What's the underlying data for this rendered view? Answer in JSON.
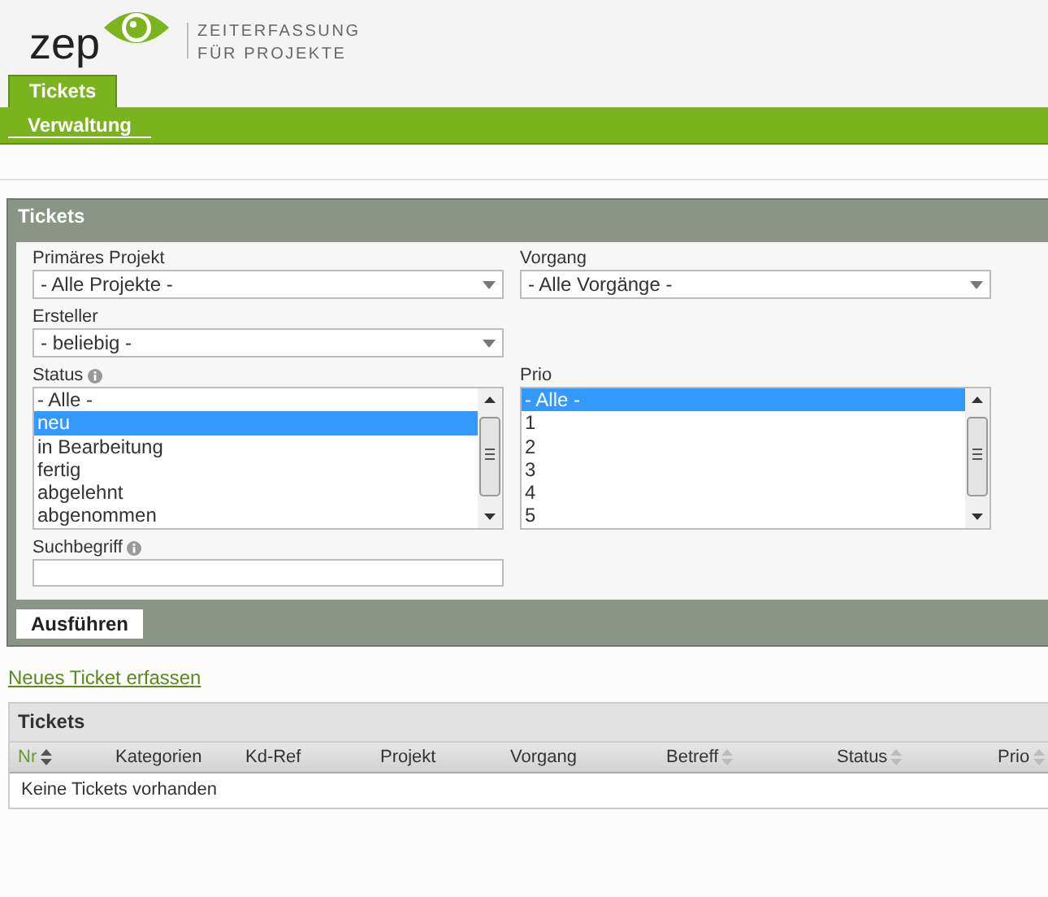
{
  "logo": {
    "wordmark": "zep",
    "tagline_1": "ZEITERFASSUNG",
    "tagline_2": "FÜR PROJEKTE"
  },
  "tabs": [
    {
      "label": "Tickets",
      "selected": true
    }
  ],
  "subnav": [
    {
      "label": "Verwaltung",
      "selected": true
    }
  ],
  "filter_panel": {
    "title": "Tickets",
    "primary_project": {
      "label": "Primäres Projekt",
      "value": "- Alle Projekte -"
    },
    "process": {
      "label": "Vorgang",
      "value": "- Alle Vorgänge -"
    },
    "creator": {
      "label": "Ersteller",
      "value": "- beliebig -"
    },
    "status": {
      "label": "Status",
      "info": true,
      "options": [
        {
          "label": "- Alle -",
          "selected": false
        },
        {
          "label": "neu",
          "selected": true
        },
        {
          "label": "in Bearbeitung",
          "selected": false
        },
        {
          "label": "fertig",
          "selected": false
        },
        {
          "label": "abgelehnt",
          "selected": false
        },
        {
          "label": "abgenommen",
          "selected": false
        }
      ]
    },
    "prio": {
      "label": "Prio",
      "info": false,
      "options": [
        {
          "label": "- Alle -",
          "selected": true
        },
        {
          "label": "1",
          "selected": false
        },
        {
          "label": "2",
          "selected": false
        },
        {
          "label": "3",
          "selected": false
        },
        {
          "label": "4",
          "selected": false
        },
        {
          "label": "5",
          "selected": false
        }
      ]
    },
    "search": {
      "label": "Suchbegriff",
      "info": true
    },
    "submit": "Ausführen"
  },
  "new_ticket_link": "Neues Ticket erfassen",
  "table": {
    "title": "Tickets",
    "columns": [
      {
        "label": "Nr",
        "sortable": true,
        "selected": true
      },
      {
        "label": "Kategorien",
        "sortable": false,
        "selected": false
      },
      {
        "label": "Kd-Ref",
        "sortable": false,
        "selected": false
      },
      {
        "label": "Projekt",
        "sortable": false,
        "selected": false
      },
      {
        "label": "Vorgang",
        "sortable": false,
        "selected": false
      },
      {
        "label": "Betreff",
        "sortable": true,
        "selected": false
      },
      {
        "label": "Status",
        "sortable": true,
        "selected": false
      },
      {
        "label": "Prio",
        "sortable": true,
        "selected": false
      }
    ],
    "empty_message": "Keine Tickets vorhanden"
  }
}
